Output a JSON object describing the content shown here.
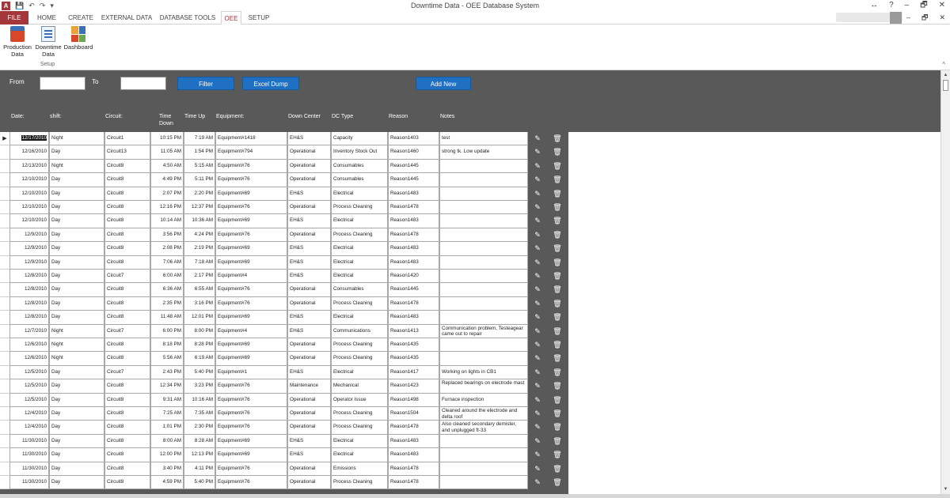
{
  "window": {
    "title": "Downtime Data - OEE Database System",
    "app_logo": "A",
    "controls": [
      "↔",
      "?",
      "–",
      "🗗",
      "✕"
    ],
    "doc_controls": [
      "–",
      "🗗",
      "✕"
    ]
  },
  "ribbon": {
    "tabs": [
      "FILE",
      "HOME",
      "CREATE",
      "EXTERNAL DATA",
      "DATABASE TOOLS",
      "OEE",
      "SETUP"
    ],
    "active_tab": "OEE",
    "buttons": [
      {
        "label": "Production Data",
        "icon": "production-data-icon"
      },
      {
        "label": "Downtime Data",
        "icon": "downtime-data-icon"
      },
      {
        "label": "Dashboard",
        "icon": "dashboard-icon"
      }
    ],
    "group_label": "Setup"
  },
  "filter": {
    "from_label": "From",
    "to_label": "To",
    "from_value": "",
    "to_value": "",
    "filter_button": "Filter",
    "excel_button": "Excel Dump",
    "add_button": "Add New"
  },
  "columns": [
    "Date:",
    "shift:",
    "Circuit:",
    "Time Down",
    "Time Up",
    "Equipment:",
    "Down Center",
    "DC Type",
    "Reason",
    "Notes"
  ],
  "rows": [
    {
      "date": "12/17/2010",
      "shift": "Night",
      "circuit": "Circuit1",
      "down": "10:15 PM",
      "up": "7:19 AM",
      "equip": "Equipment#1418",
      "center": "EH&S",
      "type": "Capacity",
      "reason": "Reason1403",
      "notes": "test"
    },
    {
      "date": "12/16/2010",
      "shift": "Day",
      "circuit": "Circuit13",
      "down": "11:05 AM",
      "up": "1:54 PM",
      "equip": "Equipment#794",
      "center": "Operational",
      "type": "Inventory Stock Out",
      "reason": "Reason1460",
      "notes": "strong tk. Low update"
    },
    {
      "date": "12/13/2010",
      "shift": "Night",
      "circuit": "Circuit8",
      "down": "4:50 AM",
      "up": "5:15 AM",
      "equip": "Equipment#76",
      "center": "Operational",
      "type": "Consumables",
      "reason": "Reason1445",
      "notes": ""
    },
    {
      "date": "12/10/2010",
      "shift": "Day",
      "circuit": "Circuit8",
      "down": "4:49 PM",
      "up": "5:11 PM",
      "equip": "Equipment#76",
      "center": "Operational",
      "type": "Consumables",
      "reason": "Reason1445",
      "notes": ""
    },
    {
      "date": "12/10/2010",
      "shift": "Day",
      "circuit": "Circuit8",
      "down": "2:07 PM",
      "up": "2:20 PM",
      "equip": "Equipment#69",
      "center": "EH&S",
      "type": "Electrical",
      "reason": "Reason1483",
      "notes": ""
    },
    {
      "date": "12/10/2010",
      "shift": "Day",
      "circuit": "Circuit8",
      "down": "12:16 PM",
      "up": "12:37 PM",
      "equip": "Equipment#76",
      "center": "Operational",
      "type": "Process Cleaning",
      "reason": "Reason1478",
      "notes": ""
    },
    {
      "date": "12/10/2010",
      "shift": "Day",
      "circuit": "Circuit8",
      "down": "10:14 AM",
      "up": "10:36 AM",
      "equip": "Equipment#69",
      "center": "EH&S",
      "type": "Electrical",
      "reason": "Reason1483",
      "notes": ""
    },
    {
      "date": "12/9/2010",
      "shift": "Day",
      "circuit": "Circuit8",
      "down": "3:56 PM",
      "up": "4:24 PM",
      "equip": "Equipment#76",
      "center": "Operational",
      "type": "Process Cleaning",
      "reason": "Reason1478",
      "notes": ""
    },
    {
      "date": "12/9/2010",
      "shift": "Day",
      "circuit": "Circuit8",
      "down": "2:08 PM",
      "up": "2:19 PM",
      "equip": "Equipment#69",
      "center": "EH&S",
      "type": "Electrical",
      "reason": "Reason1483",
      "notes": ""
    },
    {
      "date": "12/9/2010",
      "shift": "Day",
      "circuit": "Circuit8",
      "down": "7:06 AM",
      "up": "7:18 AM",
      "equip": "Equipment#69",
      "center": "EH&S",
      "type": "Electrical",
      "reason": "Reason1483",
      "notes": ""
    },
    {
      "date": "12/8/2010",
      "shift": "Day",
      "circuit": "Circuit7",
      "down": "6:00 AM",
      "up": "2:17 PM",
      "equip": "Equipment#4",
      "center": "EH&S",
      "type": "Electrical",
      "reason": "Reason1420",
      "notes": ""
    },
    {
      "date": "12/8/2010",
      "shift": "Day",
      "circuit": "Circuit8",
      "down": "6:36 AM",
      "up": "6:55 AM",
      "equip": "Equipment#76",
      "center": "Operational",
      "type": "Consumables",
      "reason": "Reason1445",
      "notes": ""
    },
    {
      "date": "12/8/2010",
      "shift": "Day",
      "circuit": "Circuit8",
      "down": "2:35 PM",
      "up": "3:16 PM",
      "equip": "Equipment#76",
      "center": "Operational",
      "type": "Process Cleaning",
      "reason": "Reason1478",
      "notes": ""
    },
    {
      "date": "12/8/2010",
      "shift": "Day",
      "circuit": "Circuit8",
      "down": "11:48 AM",
      "up": "12:01 PM",
      "equip": "Equipment#69",
      "center": "EH&S",
      "type": "Electrical",
      "reason": "Reason1483",
      "notes": ""
    },
    {
      "date": "12/7/2010",
      "shift": "Night",
      "circuit": "Circuit7",
      "down": "6:00 PM",
      "up": "8:00 PM",
      "equip": "Equipment#4",
      "center": "EH&S",
      "type": "Communications",
      "reason": "Reason1413",
      "notes": "Communication problem, Testeagear came out to repair"
    },
    {
      "date": "12/6/2010",
      "shift": "Night",
      "circuit": "Circuit8",
      "down": "8:18 PM",
      "up": "8:28 PM",
      "equip": "Equipment#69",
      "center": "Operational",
      "type": "Process Cleaning",
      "reason": "Reason1435",
      "notes": ""
    },
    {
      "date": "12/6/2010",
      "shift": "Night",
      "circuit": "Circuit8",
      "down": "5:56 AM",
      "up": "6:19 AM",
      "equip": "Equipment#69",
      "center": "Operational",
      "type": "Process Cleaning",
      "reason": "Reason1435",
      "notes": ""
    },
    {
      "date": "12/5/2010",
      "shift": "Day",
      "circuit": "Circuit7",
      "down": "2:43 PM",
      "up": "5:40 PM",
      "equip": "Equipment#1",
      "center": "EH&S",
      "type": "Electrical",
      "reason": "Reason1417",
      "notes": "Working on lights in CB1"
    },
    {
      "date": "12/5/2010",
      "shift": "Day",
      "circuit": "Circuit8",
      "down": "12:34 PM",
      "up": "3:23 PM",
      "equip": "Equipment#76",
      "center": "Maintenance",
      "type": "Mechanical",
      "reason": "Reason1423",
      "notes": "Replaced bearings on electrode mast"
    },
    {
      "date": "12/5/2010",
      "shift": "Day",
      "circuit": "Circuit8",
      "down": "9:31 AM",
      "up": "10:16 AM",
      "equip": "Equipment#76",
      "center": "Operational",
      "type": "Operator Issue",
      "reason": "Reason1498",
      "notes": "Furnace inspection"
    },
    {
      "date": "12/4/2010",
      "shift": "Day",
      "circuit": "Circuit8",
      "down": "7:25 AM",
      "up": "7:35 AM",
      "equip": "Equipment#76",
      "center": "Operational",
      "type": "Process Cleaning",
      "reason": "Reason1504",
      "notes": "Cleaned around the electrode and delta roof"
    },
    {
      "date": "12/4/2010",
      "shift": "Day",
      "circuit": "Circuit8",
      "down": "1:01 PM",
      "up": "2:30 PM",
      "equip": "Equipment#76",
      "center": "Operational",
      "type": "Process Cleaning",
      "reason": "Reason1478",
      "notes": "Also cleaned secondary demister, and unplugged ft-33"
    },
    {
      "date": "11/30/2010",
      "shift": "Day",
      "circuit": "Circuit8",
      "down": "8:00 AM",
      "up": "8:28 AM",
      "equip": "Equipment#69",
      "center": "EH&S",
      "type": "Electrical",
      "reason": "Reason1483",
      "notes": ""
    },
    {
      "date": "11/30/2010",
      "shift": "Day",
      "circuit": "Circuit8",
      "down": "12:00 PM",
      "up": "12:13 PM",
      "equip": "Equipment#69",
      "center": "EH&S",
      "type": "Electrical",
      "reason": "Reason1483",
      "notes": ""
    },
    {
      "date": "11/30/2010",
      "shift": "Day",
      "circuit": "Circuit8",
      "down": "3:40 PM",
      "up": "4:11 PM",
      "equip": "Equipment#76",
      "center": "Operational",
      "type": "Emissions",
      "reason": "Reason1478",
      "notes": ""
    },
    {
      "date": "11/30/2010",
      "shift": "Day",
      "circuit": "Circuit8",
      "down": "4:59 PM",
      "up": "5:40 PM",
      "equip": "Equipment#76",
      "center": "Operational",
      "type": "Process Cleaning",
      "reason": "Reason1478",
      "notes": ""
    }
  ],
  "row_actions": {
    "edit_glyph": "✎",
    "delete_glyph": "🗑"
  },
  "record_selector_glyph": "▶",
  "colors": {
    "header_bg": "#595959",
    "button_blue": "#1f6fc3",
    "file_tab": "#a4373a"
  }
}
